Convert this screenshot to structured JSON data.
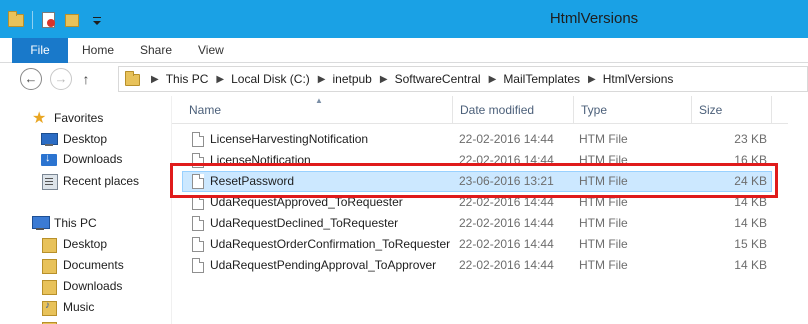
{
  "window": {
    "title": "HtmlVersions"
  },
  "quick_access_toolbar": {
    "icons": [
      "folder-icon",
      "properties-icon",
      "new-folder-icon",
      "customize-dropdown-icon"
    ]
  },
  "ribbon": {
    "file_label": "File",
    "tabs": [
      "Home",
      "Share",
      "View"
    ]
  },
  "address_bar": {
    "breadcrumbs": [
      "This PC",
      "Local Disk (C:)",
      "inetpub",
      "SoftwareCentral",
      "MailTemplates",
      "HtmlVersions"
    ]
  },
  "navigation_pane": {
    "favorites_label": "Favorites",
    "favorites": [
      "Desktop",
      "Downloads",
      "Recent places"
    ],
    "this_pc_label": "This PC",
    "this_pc": [
      "Desktop",
      "Documents",
      "Downloads",
      "Music"
    ]
  },
  "file_list": {
    "columns": {
      "name": "Name",
      "date_modified": "Date modified",
      "type": "Type",
      "size": "Size"
    },
    "files": [
      {
        "name": "LicenseHarvestingNotification",
        "date": "22-02-2016 14:44",
        "type": "HTM File",
        "size": "23 KB",
        "selected": false
      },
      {
        "name": "LicenseNotification",
        "date": "22-02-2016 14:44",
        "type": "HTM File",
        "size": "16 KB",
        "selected": false
      },
      {
        "name": "ResetPassword",
        "date": "23-06-2016 13:21",
        "type": "HTM File",
        "size": "24 KB",
        "selected": true
      },
      {
        "name": "UdaRequestApproved_ToRequester",
        "date": "22-02-2016 14:44",
        "type": "HTM File",
        "size": "14 KB",
        "selected": false
      },
      {
        "name": "UdaRequestDeclined_ToRequester",
        "date": "22-02-2016 14:44",
        "type": "HTM File",
        "size": "14 KB",
        "selected": false
      },
      {
        "name": "UdaRequestOrderConfirmation_ToRequester",
        "date": "22-02-2016 14:44",
        "type": "HTM File",
        "size": "15 KB",
        "selected": false
      },
      {
        "name": "UdaRequestPendingApproval_ToApprover",
        "date": "22-02-2016 14:44",
        "type": "HTM File",
        "size": "14 KB",
        "selected": false
      }
    ]
  },
  "colors": {
    "titlebar": "#1aa1e5",
    "file_tab": "#1979ca",
    "selection": "#cce8ff",
    "annotation_box": "#e01b1b"
  }
}
